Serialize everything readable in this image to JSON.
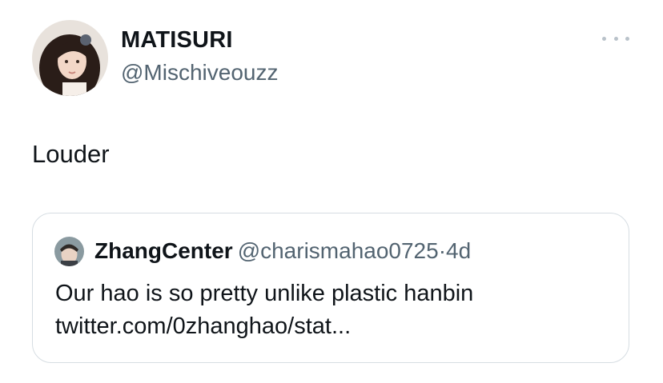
{
  "tweet": {
    "author": {
      "display_name": "MATISURI",
      "handle": "@Mischiveouzz",
      "avatar_icon": "user-avatar-photo"
    },
    "more_icon": "more-options-icon",
    "text": "Louder"
  },
  "quoted_tweet": {
    "author": {
      "display_name": "ZhangCenter",
      "handle": "@charismahao0725",
      "avatar_icon": "user-avatar-photo"
    },
    "separator": "·",
    "timestamp": "4d",
    "text_line1": "Our hao is so pretty unlike plastic hanbin",
    "text_line2": "twitter.com/0zhanghao/stat..."
  },
  "colors": {
    "primary_text": "#0f1419",
    "secondary_text": "#536471",
    "border": "#d6dde2"
  }
}
